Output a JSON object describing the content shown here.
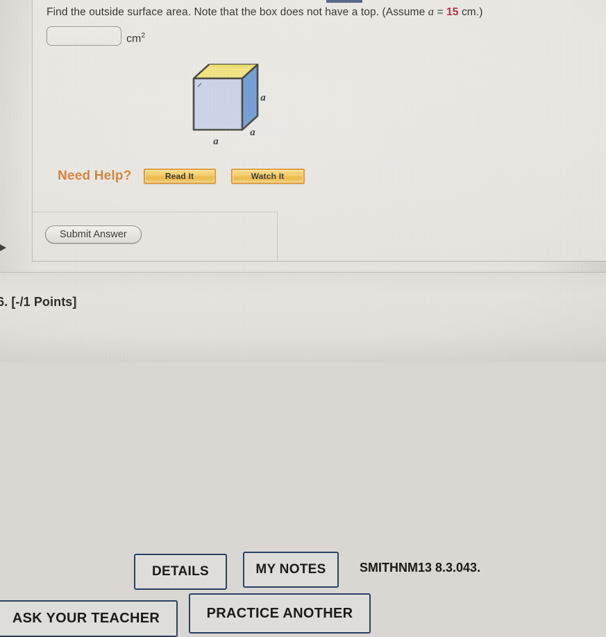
{
  "question": {
    "prompt_part1": "Find the outside surface area. Note that the box does not have a top. (Assume ",
    "prompt_var": "a",
    "prompt_equals": " = ",
    "prompt_value": "15",
    "prompt_part2": " cm.)",
    "answer_value": "",
    "answer_placeholder": "",
    "unit": "cm",
    "unit_exponent": "2"
  },
  "figure": {
    "name": "open-top-cube",
    "label_width": "a",
    "label_height": "a",
    "label_depth": "a",
    "colors": {
      "front_face": "#c5cde4",
      "right_face": "#5c8fcc",
      "interior_top": "#f0e070",
      "interior_back": "#e8d95e",
      "outline": "#2b2a28"
    }
  },
  "help": {
    "label": "Need Help?",
    "read_it": "Read It",
    "watch_it": "Watch It",
    "accent_color": "#cc7222",
    "button_color": "#f3c64d"
  },
  "submit": {
    "label": "Submit Answer"
  },
  "next_problem": {
    "points": "6. [-/1 Points]",
    "details": "DETAILS",
    "my_notes": "MY NOTES",
    "assignment_code": "SMITHNM13 8.3.043.",
    "ask_teacher": "ASK YOUR TEACHER",
    "practice_another": "PRACTICE ANOTHER",
    "border_color": "#2c3f63"
  }
}
